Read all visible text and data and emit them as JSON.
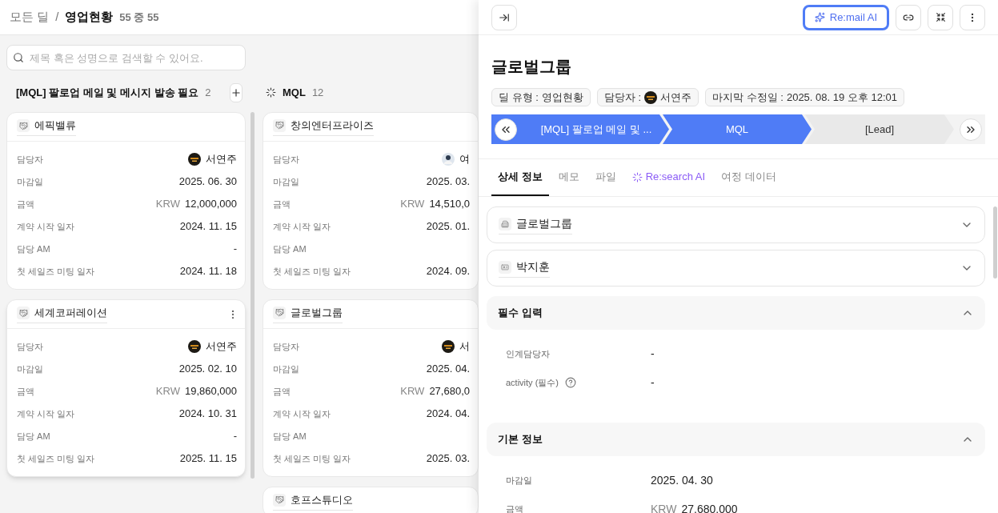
{
  "breadcrumb": {
    "parent": "모든 딜",
    "separator": "/",
    "current": "영업현황",
    "count": "55 중 55"
  },
  "search": {
    "placeholder": "제목 혹은 성명으로 검색할 수 있어요."
  },
  "columns": [
    {
      "title": "[MQL] 팔로업 메일 및 메시지 발송 필요",
      "count": "2",
      "add_button": true,
      "cards": [
        {
          "title": "에픽밸류",
          "hovered": false,
          "fields": [
            {
              "label": "담당자",
              "kind": "owner",
              "value": "서연주"
            },
            {
              "label": "마감일",
              "kind": "text",
              "value": "2025. 06. 30"
            },
            {
              "label": "금액",
              "kind": "money",
              "currency": "KRW",
              "value": "12,000,000"
            },
            {
              "label": "계약 시작 일자",
              "kind": "text",
              "value": "2024. 11. 15"
            },
            {
              "label": "담당 AM",
              "kind": "text",
              "value": "-"
            },
            {
              "label": "첫 세일즈 미팅 일자",
              "kind": "text",
              "value": "2024. 11. 18"
            }
          ]
        },
        {
          "title": "세계코퍼레이션",
          "hovered": true,
          "fields": [
            {
              "label": "담당자",
              "kind": "owner",
              "value": "서연주"
            },
            {
              "label": "마감일",
              "kind": "text",
              "value": "2025. 02. 10"
            },
            {
              "label": "금액",
              "kind": "money",
              "currency": "KRW",
              "value": "19,860,000"
            },
            {
              "label": "계약 시작 일자",
              "kind": "text",
              "value": "2024. 10. 31"
            },
            {
              "label": "담당 AM",
              "kind": "text",
              "value": "-"
            },
            {
              "label": "첫 세일즈 미팅 일자",
              "kind": "text",
              "value": "2025. 11. 15"
            }
          ]
        }
      ]
    },
    {
      "title": "MQL",
      "count": "12",
      "add_button": false,
      "cards": [
        {
          "title": "창의엔터프라이즈",
          "hovered": false,
          "fields": [
            {
              "label": "담당자",
              "kind": "portrait",
              "value": "여"
            },
            {
              "label": "마감일",
              "kind": "text",
              "value": "2025. 03."
            },
            {
              "label": "금액",
              "kind": "money",
              "currency": "KRW",
              "value": "14,510,0"
            },
            {
              "label": "계약 시작 일자",
              "kind": "text",
              "value": "2025. 01."
            },
            {
              "label": "담당 AM",
              "kind": "empty"
            },
            {
              "label": "첫 세일즈 미팅 일자",
              "kind": "text",
              "value": "2024. 09."
            }
          ]
        },
        {
          "title": "글로벌그룹",
          "hovered": false,
          "fields": [
            {
              "label": "담당자",
              "kind": "owner",
              "value": "서"
            },
            {
              "label": "마감일",
              "kind": "text",
              "value": "2025. 04."
            },
            {
              "label": "금액",
              "kind": "money",
              "currency": "KRW",
              "value": "27,680,0"
            },
            {
              "label": "계약 시작 일자",
              "kind": "text",
              "value": "2024. 04."
            },
            {
              "label": "담당 AM",
              "kind": "empty"
            },
            {
              "label": "첫 세일즈 미팅 일자",
              "kind": "text",
              "value": "2025. 03."
            }
          ]
        },
        {
          "title": "호프스튜디오",
          "hovered": false
        }
      ]
    }
  ],
  "panel": {
    "ai_button": "Re:mail AI",
    "title": "글로벌그룹",
    "chips": [
      {
        "label": "딜 유형 :",
        "value": "영업현황",
        "avatar": false
      },
      {
        "label": "담당자 :",
        "value": "서연주",
        "avatar": true
      },
      {
        "label": "마지막 수정일 :",
        "value": "2025. 08. 19 오후 12:01",
        "avatar": false
      }
    ],
    "stages": [
      {
        "name": "[MQL] 팔로업 메일 및 ...",
        "reached": true
      },
      {
        "name": "MQL",
        "reached": true
      },
      {
        "name": "[Lead]",
        "reached": false
      }
    ],
    "tabs": [
      {
        "label": "상세 정보",
        "selected": true,
        "kind": "plain"
      },
      {
        "label": "메모",
        "selected": false,
        "kind": "plain"
      },
      {
        "label": "파일",
        "selected": false,
        "kind": "plain"
      },
      {
        "label": "Re:search AI",
        "selected": false,
        "kind": "ai"
      },
      {
        "label": "여정 데이터",
        "selected": false,
        "kind": "plain"
      }
    ],
    "sections": [
      {
        "kind": "link",
        "title": "글로벌그룹",
        "expanded": false
      },
      {
        "kind": "link",
        "title": "박지훈",
        "expanded": false
      },
      {
        "kind": "group",
        "title": "필수 입력",
        "expanded": true,
        "fields": [
          {
            "label": "인계담당자",
            "help": false,
            "kind": "text",
            "value": "-"
          },
          {
            "label": "activity (필수)",
            "help": true,
            "kind": "text",
            "value": "-"
          }
        ]
      },
      {
        "kind": "group",
        "title": "기본 정보",
        "expanded": true,
        "fields": [
          {
            "label": "마감일",
            "help": false,
            "kind": "text",
            "value": "2025. 04. 30"
          },
          {
            "label": "금액",
            "help": false,
            "kind": "money",
            "currency": "KRW",
            "value": "27,680,000"
          }
        ]
      }
    ]
  }
}
